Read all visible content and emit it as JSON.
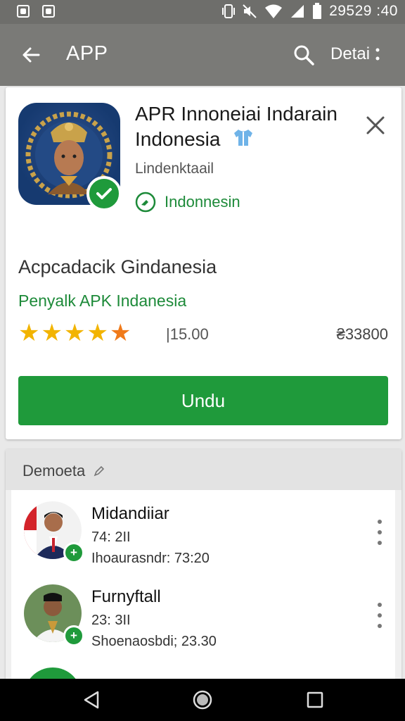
{
  "status_bar": {
    "time": "29529 :40"
  },
  "app_bar": {
    "title": "APP",
    "detail_label": "Detai"
  },
  "app_card": {
    "name_line1": "APR Innoneiai Indarain",
    "name_line2": "Indonesia",
    "developer": "Lindenktaail",
    "region": "Indonnesin",
    "subtitle": "Acpcadacik Gindanesia",
    "publisher": "Penyalk APK Indanesia",
    "stars": 5,
    "rating": "|15.00",
    "downloads": "₴33800",
    "download_button": "Undu"
  },
  "section": {
    "title": "Demoeta",
    "items": [
      {
        "name": "Midandiiar",
        "line1": "74: 2II",
        "line2": "Ihoaurasndr: 73:20"
      },
      {
        "name": "Furnyftall",
        "line1": "23: 3II",
        "line2": "Shoenaosbdi; 23.30"
      }
    ]
  },
  "colors": {
    "accent_green": "#1f9a3b",
    "app_bar": "#7a7a77",
    "star": "#f2b400"
  }
}
